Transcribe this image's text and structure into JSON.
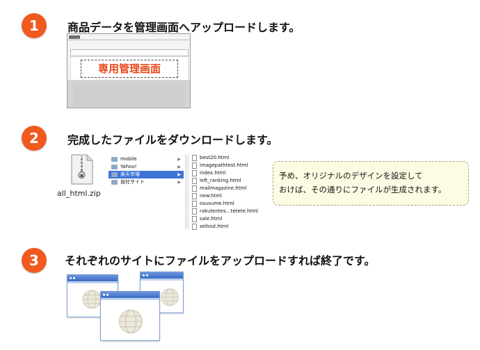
{
  "steps": [
    {
      "number": "1",
      "title": "商品データを管理画面へアップロードします。"
    },
    {
      "number": "2",
      "title": "完成したファイルをダウンロードします。"
    },
    {
      "number": "3",
      "title": "それぞれのサイトにファイルをアップロードすれば終了です。"
    }
  ],
  "admin": {
    "stamp": "専用管理画面"
  },
  "download": {
    "zip_name": "all_html.zip",
    "folders": [
      "mobile",
      "Yahoo!",
      "楽天市場",
      "自社サイト"
    ],
    "selected_folder": "楽天市場",
    "files": [
      "best20.html",
      "imagepathtest.html",
      "index.html",
      "left_ranking.html",
      "mailmagazine.html",
      "new.html",
      "osusume.html",
      "rakutentes…tetete.html",
      "sale.html",
      "sellout.html"
    ]
  },
  "note": {
    "line1": "予め、オリジナルのデザインを設定して",
    "line2": "おけば、その通りにファイルが生成されます。"
  },
  "colors": {
    "accent": "#f05a1e",
    "selection": "#3d74d6",
    "window_bar": "#3a6bc4"
  }
}
